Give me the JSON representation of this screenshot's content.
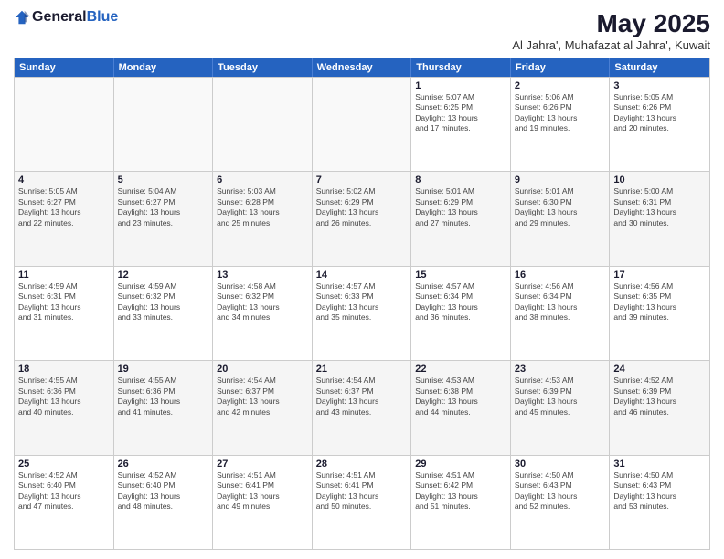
{
  "header": {
    "logo_general": "General",
    "logo_blue": "Blue",
    "month": "May 2025",
    "location": "Al Jahra', Muhafazat al Jahra', Kuwait"
  },
  "days_of_week": [
    "Sunday",
    "Monday",
    "Tuesday",
    "Wednesday",
    "Thursday",
    "Friday",
    "Saturday"
  ],
  "weeks": [
    [
      {
        "day": "",
        "info": ""
      },
      {
        "day": "",
        "info": ""
      },
      {
        "day": "",
        "info": ""
      },
      {
        "day": "",
        "info": ""
      },
      {
        "day": "1",
        "info": "Sunrise: 5:07 AM\nSunset: 6:25 PM\nDaylight: 13 hours\nand 17 minutes."
      },
      {
        "day": "2",
        "info": "Sunrise: 5:06 AM\nSunset: 6:26 PM\nDaylight: 13 hours\nand 19 minutes."
      },
      {
        "day": "3",
        "info": "Sunrise: 5:05 AM\nSunset: 6:26 PM\nDaylight: 13 hours\nand 20 minutes."
      }
    ],
    [
      {
        "day": "4",
        "info": "Sunrise: 5:05 AM\nSunset: 6:27 PM\nDaylight: 13 hours\nand 22 minutes."
      },
      {
        "day": "5",
        "info": "Sunrise: 5:04 AM\nSunset: 6:27 PM\nDaylight: 13 hours\nand 23 minutes."
      },
      {
        "day": "6",
        "info": "Sunrise: 5:03 AM\nSunset: 6:28 PM\nDaylight: 13 hours\nand 25 minutes."
      },
      {
        "day": "7",
        "info": "Sunrise: 5:02 AM\nSunset: 6:29 PM\nDaylight: 13 hours\nand 26 minutes."
      },
      {
        "day": "8",
        "info": "Sunrise: 5:01 AM\nSunset: 6:29 PM\nDaylight: 13 hours\nand 27 minutes."
      },
      {
        "day": "9",
        "info": "Sunrise: 5:01 AM\nSunset: 6:30 PM\nDaylight: 13 hours\nand 29 minutes."
      },
      {
        "day": "10",
        "info": "Sunrise: 5:00 AM\nSunset: 6:31 PM\nDaylight: 13 hours\nand 30 minutes."
      }
    ],
    [
      {
        "day": "11",
        "info": "Sunrise: 4:59 AM\nSunset: 6:31 PM\nDaylight: 13 hours\nand 31 minutes."
      },
      {
        "day": "12",
        "info": "Sunrise: 4:59 AM\nSunset: 6:32 PM\nDaylight: 13 hours\nand 33 minutes."
      },
      {
        "day": "13",
        "info": "Sunrise: 4:58 AM\nSunset: 6:32 PM\nDaylight: 13 hours\nand 34 minutes."
      },
      {
        "day": "14",
        "info": "Sunrise: 4:57 AM\nSunset: 6:33 PM\nDaylight: 13 hours\nand 35 minutes."
      },
      {
        "day": "15",
        "info": "Sunrise: 4:57 AM\nSunset: 6:34 PM\nDaylight: 13 hours\nand 36 minutes."
      },
      {
        "day": "16",
        "info": "Sunrise: 4:56 AM\nSunset: 6:34 PM\nDaylight: 13 hours\nand 38 minutes."
      },
      {
        "day": "17",
        "info": "Sunrise: 4:56 AM\nSunset: 6:35 PM\nDaylight: 13 hours\nand 39 minutes."
      }
    ],
    [
      {
        "day": "18",
        "info": "Sunrise: 4:55 AM\nSunset: 6:36 PM\nDaylight: 13 hours\nand 40 minutes."
      },
      {
        "day": "19",
        "info": "Sunrise: 4:55 AM\nSunset: 6:36 PM\nDaylight: 13 hours\nand 41 minutes."
      },
      {
        "day": "20",
        "info": "Sunrise: 4:54 AM\nSunset: 6:37 PM\nDaylight: 13 hours\nand 42 minutes."
      },
      {
        "day": "21",
        "info": "Sunrise: 4:54 AM\nSunset: 6:37 PM\nDaylight: 13 hours\nand 43 minutes."
      },
      {
        "day": "22",
        "info": "Sunrise: 4:53 AM\nSunset: 6:38 PM\nDaylight: 13 hours\nand 44 minutes."
      },
      {
        "day": "23",
        "info": "Sunrise: 4:53 AM\nSunset: 6:39 PM\nDaylight: 13 hours\nand 45 minutes."
      },
      {
        "day": "24",
        "info": "Sunrise: 4:52 AM\nSunset: 6:39 PM\nDaylight: 13 hours\nand 46 minutes."
      }
    ],
    [
      {
        "day": "25",
        "info": "Sunrise: 4:52 AM\nSunset: 6:40 PM\nDaylight: 13 hours\nand 47 minutes."
      },
      {
        "day": "26",
        "info": "Sunrise: 4:52 AM\nSunset: 6:40 PM\nDaylight: 13 hours\nand 48 minutes."
      },
      {
        "day": "27",
        "info": "Sunrise: 4:51 AM\nSunset: 6:41 PM\nDaylight: 13 hours\nand 49 minutes."
      },
      {
        "day": "28",
        "info": "Sunrise: 4:51 AM\nSunset: 6:41 PM\nDaylight: 13 hours\nand 50 minutes."
      },
      {
        "day": "29",
        "info": "Sunrise: 4:51 AM\nSunset: 6:42 PM\nDaylight: 13 hours\nand 51 minutes."
      },
      {
        "day": "30",
        "info": "Sunrise: 4:50 AM\nSunset: 6:43 PM\nDaylight: 13 hours\nand 52 minutes."
      },
      {
        "day": "31",
        "info": "Sunrise: 4:50 AM\nSunset: 6:43 PM\nDaylight: 13 hours\nand 53 minutes."
      }
    ]
  ]
}
